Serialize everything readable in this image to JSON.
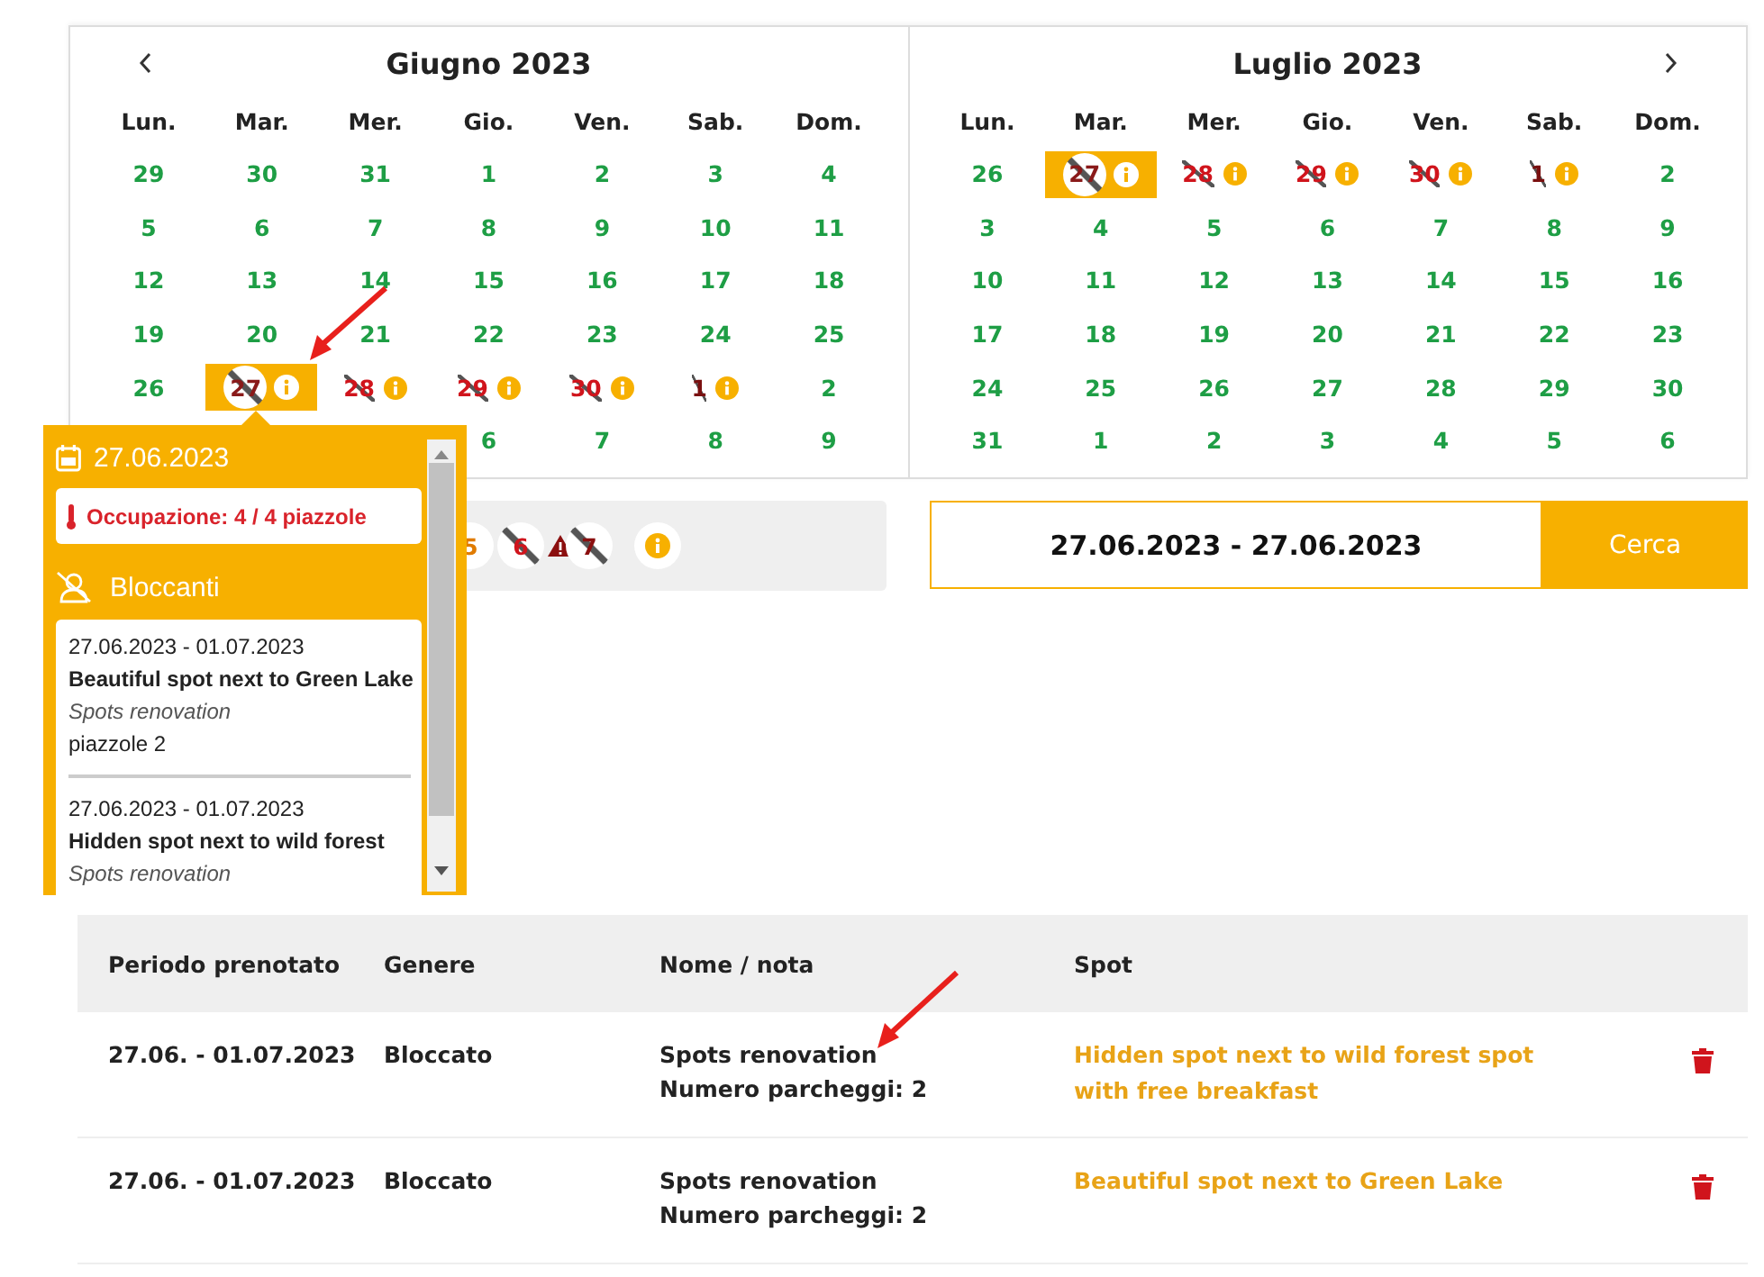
{
  "calendar": {
    "months": [
      {
        "title": "Giugno 2023",
        "prev_button": true,
        "next_button": false,
        "weekdays": [
          "Lun.",
          "Mar.",
          "Mer.",
          "Gio.",
          "Ven.",
          "Sab.",
          "Dom."
        ],
        "weeks": [
          [
            {
              "day": "29",
              "kind": "free",
              "selected": false
            },
            {
              "day": "30",
              "kind": "free",
              "selected": false
            },
            {
              "day": "31",
              "kind": "free",
              "selected": false
            },
            {
              "day": "1",
              "kind": "free",
              "selected": false
            },
            {
              "day": "2",
              "kind": "free",
              "selected": false
            },
            {
              "day": "3",
              "kind": "free",
              "selected": false
            },
            {
              "day": "4",
              "kind": "free",
              "selected": false
            }
          ],
          [
            {
              "day": "5",
              "kind": "free",
              "selected": false
            },
            {
              "day": "6",
              "kind": "free",
              "selected": false
            },
            {
              "day": "7",
              "kind": "free",
              "selected": false
            },
            {
              "day": "8",
              "kind": "free",
              "selected": false
            },
            {
              "day": "9",
              "kind": "free",
              "selected": false
            },
            {
              "day": "10",
              "kind": "free",
              "selected": false
            },
            {
              "day": "11",
              "kind": "free",
              "selected": false
            }
          ],
          [
            {
              "day": "12",
              "kind": "free",
              "selected": false
            },
            {
              "day": "13",
              "kind": "free",
              "selected": false
            },
            {
              "day": "14",
              "kind": "free",
              "selected": false
            },
            {
              "day": "15",
              "kind": "free",
              "selected": false
            },
            {
              "day": "16",
              "kind": "free",
              "selected": false
            },
            {
              "day": "17",
              "kind": "free",
              "selected": false
            },
            {
              "day": "18",
              "kind": "free",
              "selected": false
            }
          ],
          [
            {
              "day": "19",
              "kind": "free",
              "selected": false
            },
            {
              "day": "20",
              "kind": "free",
              "selected": false
            },
            {
              "day": "21",
              "kind": "free",
              "selected": false
            },
            {
              "day": "22",
              "kind": "free",
              "selected": false
            },
            {
              "day": "23",
              "kind": "free",
              "selected": false
            },
            {
              "day": "24",
              "kind": "free",
              "selected": false
            },
            {
              "day": "25",
              "kind": "free",
              "selected": false
            }
          ],
          [
            {
              "day": "26",
              "kind": "free",
              "selected": false
            },
            {
              "day": "27",
              "kind": "booked",
              "selected": true
            },
            {
              "day": "28",
              "kind": "booked",
              "selected": false
            },
            {
              "day": "29",
              "kind": "booked",
              "selected": false
            },
            {
              "day": "30",
              "kind": "booked",
              "selected": false
            },
            {
              "day": "1",
              "kind": "closed",
              "selected": false
            },
            {
              "day": "2",
              "kind": "free",
              "selected": false
            }
          ],
          [
            {
              "day": "6",
              "kind": "free",
              "selected": false
            },
            {
              "day": "7",
              "kind": "free",
              "selected": false
            },
            {
              "day": "8",
              "kind": "free",
              "selected": false
            },
            {
              "day": "9",
              "kind": "free",
              "selected": false
            }
          ]
        ]
      },
      {
        "title": "Luglio 2023",
        "prev_button": false,
        "next_button": true,
        "weekdays": [
          "Lun.",
          "Mar.",
          "Mer.",
          "Gio.",
          "Ven.",
          "Sab.",
          "Dom."
        ],
        "weeks": [
          [
            {
              "day": "26",
              "kind": "free",
              "selected": false
            },
            {
              "day": "27",
              "kind": "booked",
              "selected": true
            },
            {
              "day": "28",
              "kind": "booked",
              "selected": false
            },
            {
              "day": "29",
              "kind": "booked",
              "selected": false
            },
            {
              "day": "30",
              "kind": "booked",
              "selected": false
            },
            {
              "day": "1",
              "kind": "closed",
              "selected": false
            },
            {
              "day": "2",
              "kind": "free",
              "selected": false
            }
          ],
          [
            {
              "day": "3",
              "kind": "free",
              "selected": false
            },
            {
              "day": "4",
              "kind": "free",
              "selected": false
            },
            {
              "day": "5",
              "kind": "free",
              "selected": false
            },
            {
              "day": "6",
              "kind": "free",
              "selected": false
            },
            {
              "day": "7",
              "kind": "free",
              "selected": false
            },
            {
              "day": "8",
              "kind": "free",
              "selected": false
            },
            {
              "day": "9",
              "kind": "free",
              "selected": false
            }
          ],
          [
            {
              "day": "10",
              "kind": "free",
              "selected": false
            },
            {
              "day": "11",
              "kind": "free",
              "selected": false
            },
            {
              "day": "12",
              "kind": "free",
              "selected": false
            },
            {
              "day": "13",
              "kind": "free",
              "selected": false
            },
            {
              "day": "14",
              "kind": "free",
              "selected": false
            },
            {
              "day": "15",
              "kind": "free",
              "selected": false
            },
            {
              "day": "16",
              "kind": "free",
              "selected": false
            }
          ],
          [
            {
              "day": "17",
              "kind": "free",
              "selected": false
            },
            {
              "day": "18",
              "kind": "free",
              "selected": false
            },
            {
              "day": "19",
              "kind": "free",
              "selected": false
            },
            {
              "day": "20",
              "kind": "free",
              "selected": false
            },
            {
              "day": "21",
              "kind": "free",
              "selected": false
            },
            {
              "day": "22",
              "kind": "free",
              "selected": false
            },
            {
              "day": "23",
              "kind": "free",
              "selected": false
            }
          ],
          [
            {
              "day": "24",
              "kind": "free",
              "selected": false
            },
            {
              "day": "25",
              "kind": "free",
              "selected": false
            },
            {
              "day": "26",
              "kind": "free",
              "selected": false
            },
            {
              "day": "27",
              "kind": "free",
              "selected": false
            },
            {
              "day": "28",
              "kind": "free",
              "selected": false
            },
            {
              "day": "29",
              "kind": "free",
              "selected": false
            },
            {
              "day": "30",
              "kind": "free",
              "selected": false
            }
          ],
          [
            {
              "day": "31",
              "kind": "free",
              "selected": false
            },
            {
              "day": "1",
              "kind": "free",
              "selected": false
            },
            {
              "day": "2",
              "kind": "free",
              "selected": false
            },
            {
              "day": "3",
              "kind": "free",
              "selected": false
            },
            {
              "day": "4",
              "kind": "free",
              "selected": false
            },
            {
              "day": "5",
              "kind": "free",
              "selected": false
            },
            {
              "day": "6",
              "kind": "free",
              "selected": false
            }
          ]
        ]
      }
    ]
  },
  "legend": {
    "items": [
      {
        "kind": "partial",
        "label": "5"
      },
      {
        "kind": "full",
        "label": "6"
      },
      {
        "kind": "warning",
        "label": "7"
      },
      {
        "kind": "info"
      }
    ]
  },
  "search": {
    "value": "27.06.2023 - 27.06.2023",
    "button": "Cerca"
  },
  "popup": {
    "date": "27.06.2023",
    "occupancy": "Occupazione: 4 / 4 piazzole",
    "section": "Bloccanti",
    "entries": [
      {
        "period": "27.06.2023 - 01.07.2023",
        "spot": "Beautiful spot next to Green Lake",
        "reason": "Spots renovation",
        "spots": "piazzole 2"
      },
      {
        "period": "27.06.2023 - 01.07.2023",
        "spot": "Hidden spot next to wild forest",
        "reason": "Spots renovation"
      }
    ]
  },
  "table": {
    "columns": [
      "Periodo prenotato",
      "Genere",
      "Nome / nota",
      "Spot"
    ],
    "rows": [
      {
        "period": "27.06. - 01.07.2023",
        "type": "Bloccato",
        "name": "Spots renovation",
        "note": "Numero parcheggi: 2",
        "spot": "Hidden spot next to wild forest spot with free breakfast"
      },
      {
        "period": "27.06. - 01.07.2023",
        "type": "Bloccato",
        "name": "Spots renovation",
        "note": "Numero parcheggi: 2",
        "spot": "Beautiful spot next to Green Lake"
      }
    ]
  }
}
